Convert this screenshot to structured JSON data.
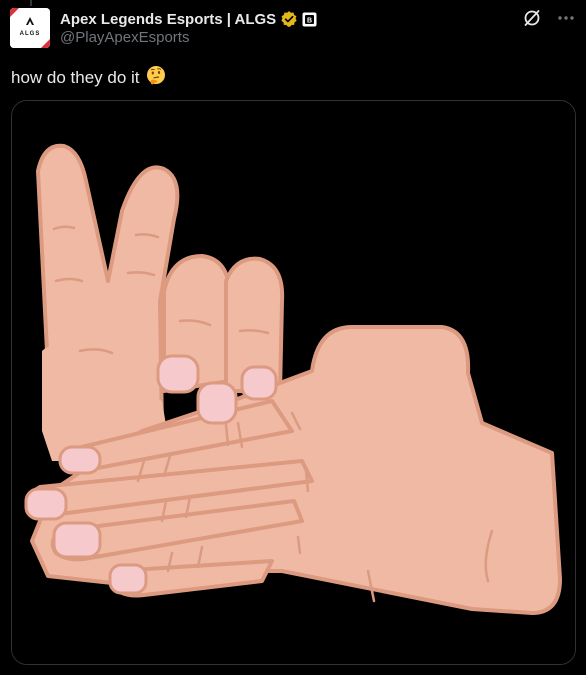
{
  "thread": {
    "has_connector_line": true
  },
  "author": {
    "display_name": "Apex Legends Esports | ALGS",
    "handle": "@PlayApexEsports",
    "avatar_text": "ALGS",
    "verified_badge_color": "#e2b719",
    "affiliate_badge_label": "B"
  },
  "tweet": {
    "text": "how do they do it",
    "emoji": "🤔"
  },
  "media": {
    "description_icon": "hands-drawing-image"
  },
  "actions": {
    "grok_icon": "grok-icon",
    "more_icon": "more-icon"
  },
  "colors": {
    "background": "#000000",
    "text": "#e7e9ea",
    "muted": "#71767b",
    "border": "#2f3336",
    "skin": "#f0b9a4",
    "skin_outline": "#dc9a80",
    "nail": "#f6c9cc"
  }
}
